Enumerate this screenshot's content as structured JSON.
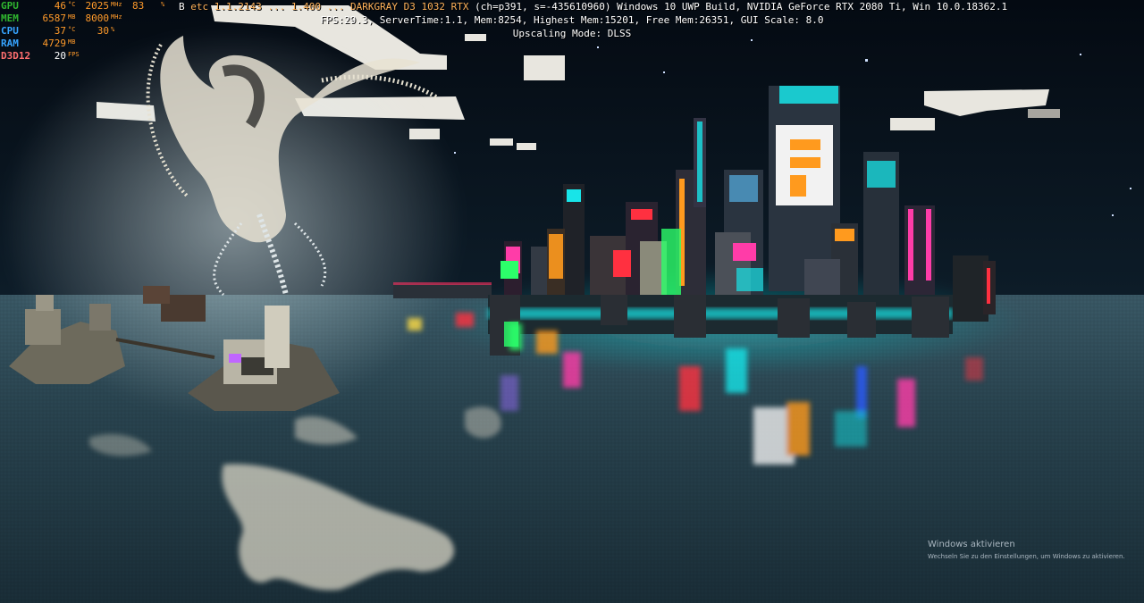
{
  "osd": {
    "rows": [
      {
        "label": "GPU",
        "v1": "46",
        "u1": "°C",
        "v2": "2025",
        "u2": "MHz",
        "v3": "83",
        "u3": "%",
        "label_color": "#2fb52f"
      },
      {
        "label": "MEM",
        "v1": "6587",
        "u1": "MB",
        "v2": "8000",
        "u2": "MHz",
        "v3": "",
        "u3": "",
        "label_color": "#2fb52f"
      },
      {
        "label": "CPU",
        "v1": "37",
        "u1": "°C",
        "v2": "30",
        "u2": "%",
        "v3": "",
        "u3": "",
        "label_color": "#37a4ff"
      },
      {
        "label": "RAM",
        "v1": "4729",
        "u1": "MB",
        "v2": "",
        "u2": "",
        "v3": "",
        "u3": "",
        "label_color": "#37a4ff"
      },
      {
        "label": "D3D12",
        "v1": "20",
        "u1": "FPS",
        "v2": "",
        "u2": "",
        "v3": "",
        "u3": "",
        "label_color": "#ff6f6f"
      }
    ]
  },
  "debug": {
    "line1_prefix": "B",
    "line1_orange": "etc 1.1.2143 ... 1.400 ... DARKGRAY D3 1032 RTX",
    "line1_suffix": "(ch=p391, s=-435610960) Windows 10 UWP Build, NVIDIA GeForce RTX 2080 Ti, Win 10.0.18362.1",
    "line2": "FPS:29.3, ServerTime:1.1, Mem:8254, Highest Mem:15201, Free Mem:26351, GUI Scale: 8.0",
    "line3": "Upscaling Mode: DLSS"
  },
  "watermark": {
    "title": "Windows aktivieren",
    "subtitle": "Wechseln Sie zu den Einstellungen, um Windows zu aktivieren."
  },
  "colors": {
    "sky": "#06101a",
    "water": "#2c4654",
    "neon_cyan": "#18e4e8",
    "neon_orange": "#ff9a1e",
    "neon_pink": "#ff3ca8",
    "neon_green": "#2cff6a"
  }
}
